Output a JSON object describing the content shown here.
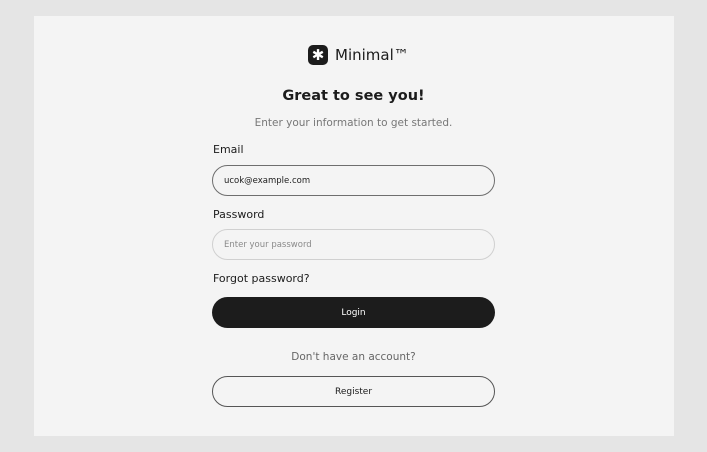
{
  "brand": {
    "logo_icon": "asterisk-icon",
    "logo_glyph": "✱",
    "name": "Minimal™"
  },
  "header": {
    "title": "Great to see you!",
    "subtitle": "Enter your information to get started."
  },
  "form": {
    "email": {
      "label": "Email",
      "value": "ucok@example.com",
      "placeholder": ""
    },
    "password": {
      "label": "Password",
      "value": "",
      "placeholder": "Enter your password"
    },
    "forgot_link": "Forgot password?",
    "login_label": "Login"
  },
  "footer": {
    "prompt": "Don't have an account?",
    "register_label": "Register"
  },
  "colors": {
    "background": "#e5e5e5",
    "card": "#f4f4f4",
    "primary": "#1c1c1c",
    "muted_text": "#777777"
  }
}
